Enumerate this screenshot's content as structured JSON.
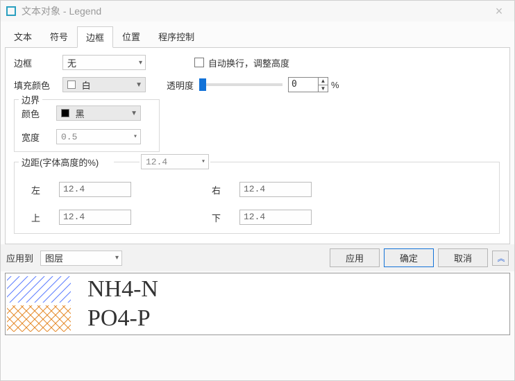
{
  "window": {
    "title": "文本对象 - Legend"
  },
  "tabs": {
    "items": [
      {
        "label": "文本"
      },
      {
        "label": "符号"
      },
      {
        "label": "边框"
      },
      {
        "label": "位置"
      },
      {
        "label": "程序控制"
      }
    ],
    "active_index": 2
  },
  "border": {
    "label": "边框",
    "value": "无"
  },
  "fill": {
    "label": "填充颜色",
    "value": "白",
    "swatch_color": "#ffffff"
  },
  "autowrap": {
    "label": "自动换行，调整高度",
    "checked": false
  },
  "opacity": {
    "label": "透明度",
    "value": "0",
    "unit": "%"
  },
  "boundary": {
    "label": "边界",
    "color_label": "颜色",
    "color_value": "黑",
    "color_swatch": "#000000",
    "width_label": "宽度",
    "width_value": "0.5"
  },
  "margins": {
    "label": "边距(字体高度的%)",
    "master_value": "12.4",
    "left_label": "左",
    "left_value": "12.4",
    "right_label": "右",
    "right_value": "12.4",
    "top_label": "上",
    "top_value": "12.4",
    "bottom_label": "下",
    "bottom_value": "12.4"
  },
  "bottom": {
    "apply_to_label": "应用到",
    "apply_to_value": "图层",
    "apply": "应用",
    "ok": "确定",
    "cancel": "取消"
  },
  "legend": {
    "items": [
      {
        "text": "NH4-N",
        "hatch": "diag-blue"
      },
      {
        "text": "PO4-P",
        "hatch": "cross-orange"
      }
    ]
  }
}
